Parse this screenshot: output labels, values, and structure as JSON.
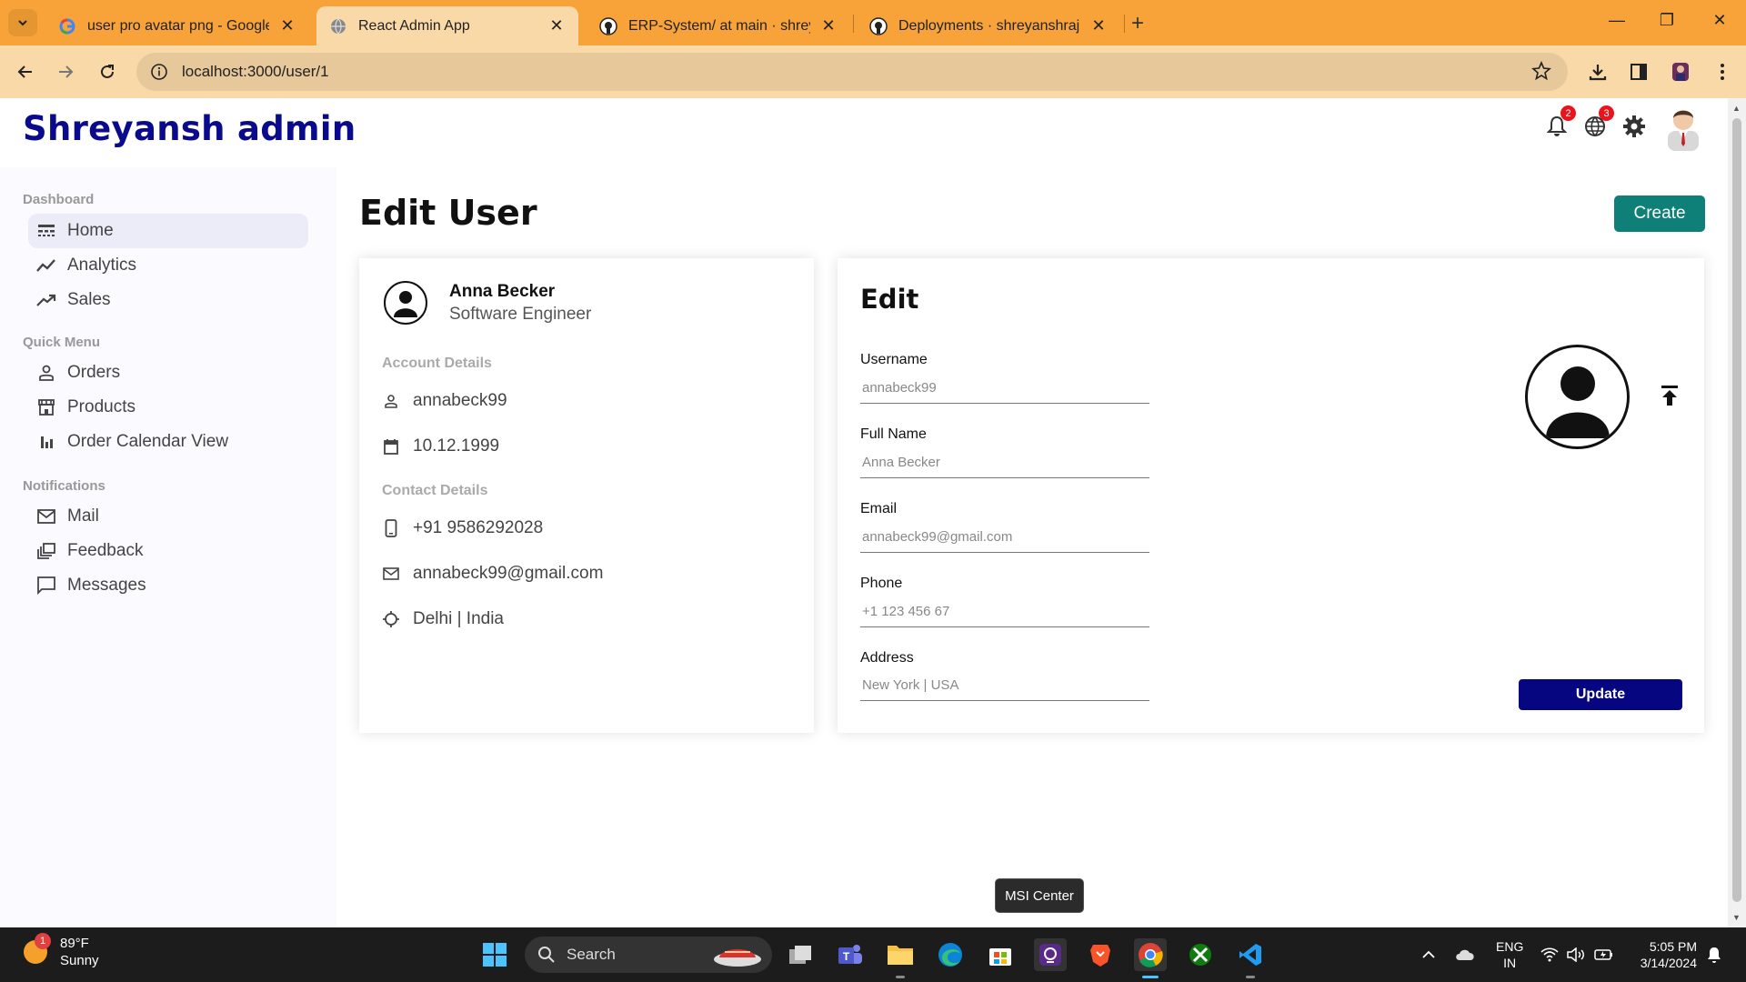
{
  "browser": {
    "tabs": [
      {
        "title": "user pro avatar png - Google Se",
        "icon": "google-icon",
        "active": false
      },
      {
        "title": "React Admin App",
        "icon": "globe-icon",
        "active": true
      },
      {
        "title": "ERP-System/ at main · shreyansh",
        "icon": "github-icon",
        "active": false
      },
      {
        "title": "Deployments · shreyanshrajak/E",
        "icon": "github-icon",
        "active": false
      }
    ],
    "url": "localhost:3000/user/1"
  },
  "app": {
    "logo": "Shreyansh admin",
    "notifications_badge": "2",
    "language_badge": "3"
  },
  "sidebar": {
    "sections": [
      {
        "title": "Dashboard",
        "items": [
          {
            "label": "Home",
            "icon": "line-style-icon",
            "active": true
          },
          {
            "label": "Analytics",
            "icon": "timeline-icon",
            "active": false
          },
          {
            "label": "Sales",
            "icon": "trending-up-icon",
            "active": false
          }
        ]
      },
      {
        "title": "Quick Menu",
        "items": [
          {
            "label": "Orders",
            "icon": "person-outline-icon",
            "active": false
          },
          {
            "label": "Products",
            "icon": "storefront-icon",
            "active": false
          },
          {
            "label": "Order Calendar View",
            "icon": "bar-chart-icon",
            "active": false
          }
        ]
      },
      {
        "title": "Notifications",
        "items": [
          {
            "label": "Mail",
            "icon": "mail-outline-icon",
            "active": false
          },
          {
            "label": "Feedback",
            "icon": "dynamic-feed-icon",
            "active": false
          },
          {
            "label": "Messages",
            "icon": "chat-bubble-icon",
            "active": false
          }
        ]
      }
    ]
  },
  "page": {
    "title": "Edit User",
    "create_label": "Create"
  },
  "show": {
    "name": "Anna Becker",
    "job": "Software Engineer",
    "account_title": "Account Details",
    "username": "annabeck99",
    "birthday": "10.12.1999",
    "contact_title": "Contact Details",
    "phone": "+91 9586292028",
    "email": "annabeck99@gmail.com",
    "location": "Delhi | India"
  },
  "edit": {
    "title": "Edit",
    "fields": [
      {
        "label": "Username",
        "placeholder": "annabeck99"
      },
      {
        "label": "Full Name",
        "placeholder": "Anna Becker"
      },
      {
        "label": "Email",
        "placeholder": "annabeck99@gmail.com"
      },
      {
        "label": "Phone",
        "placeholder": "+1 123 456 67"
      },
      {
        "label": "Address",
        "placeholder": "New York | USA"
      }
    ],
    "update_label": "Update"
  },
  "tooltip": "MSI Center",
  "taskbar": {
    "weather_temp": "89°F",
    "weather_desc": "Sunny",
    "weather_badge": "1",
    "search_label": "Search",
    "lang_top": "ENG",
    "lang_bottom": "IN",
    "time": "5:05 PM",
    "date": "3/14/2024"
  },
  "colors": {
    "tab_bar": "#f8a33a",
    "toolbar": "#f9d9a8",
    "logo": "#0a0a8c",
    "create_button": "#0f8078",
    "update_button": "#060680"
  }
}
